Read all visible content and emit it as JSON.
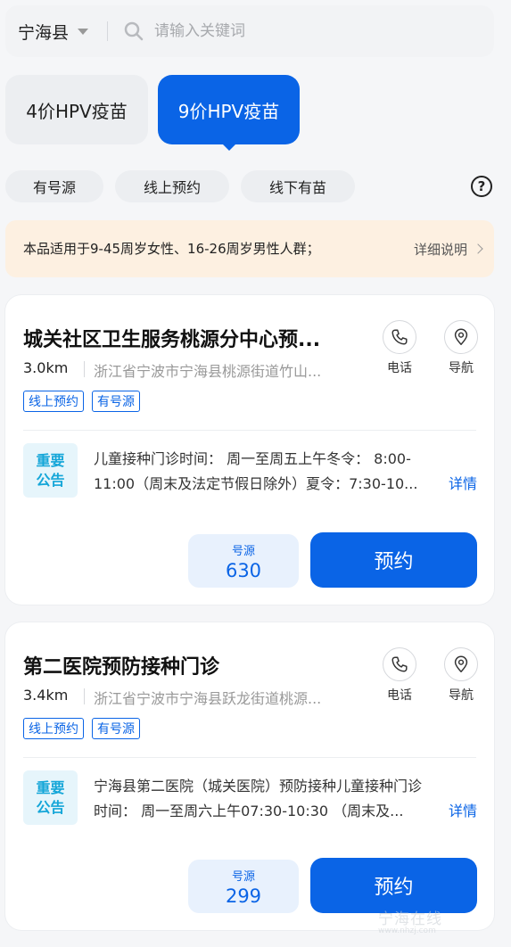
{
  "header": {
    "region": "宁海县",
    "search_placeholder": "请输入关键词"
  },
  "vaccine_tabs": [
    {
      "label": "4价HPV疫苗",
      "active": false
    },
    {
      "label": "9价HPV疫苗",
      "active": true
    }
  ],
  "filters": [
    "有号源",
    "线上预约",
    "线下有苗"
  ],
  "notice": {
    "text": "本品适用于9-45周岁女性、16-26周岁男性人群；",
    "link": "详细说明"
  },
  "cards": [
    {
      "title": "城关社区卫生服务桃源分中心预...",
      "distance": "3.0km",
      "address": "浙江省宁波市宁海县桃源街道竹山...",
      "phone_label": "电话",
      "nav_label": "导航",
      "tags": [
        "线上预约",
        "有号源"
      ],
      "badge": [
        "重要",
        "公告"
      ],
      "announcement_line1": "儿童接种门诊时间：  周一至周五上午冬令：  8:00-",
      "announcement_line2": "11:00（周末及法定节假日除外）夏令：7:30-10...",
      "more": "详情",
      "quota_label": "号源",
      "quota_value": "630",
      "book_label": "预约"
    },
    {
      "title": "第二医院预防接种门诊",
      "distance": "3.4km",
      "address": "浙江省宁波市宁海县跃龙街道桃源...",
      "phone_label": "电话",
      "nav_label": "导航",
      "tags": [
        "线上预约",
        "有号源"
      ],
      "badge": [
        "重要",
        "公告"
      ],
      "announcement_line1": "宁海县第二医院（城关医院）预防接种儿童接种门诊",
      "announcement_line2": "时间：  周一至周六上午07:30-10:30  （周末及...",
      "more": "详情",
      "quota_label": "号源",
      "quota_value": "299",
      "book_label": "预约"
    }
  ],
  "watermark": {
    "text": "宁海在线",
    "sub": "www.nhzj.com"
  },
  "colors": {
    "accent": "#0a64e6",
    "badge": "#14a6d8",
    "notice_bg": "#fdf0e1"
  }
}
